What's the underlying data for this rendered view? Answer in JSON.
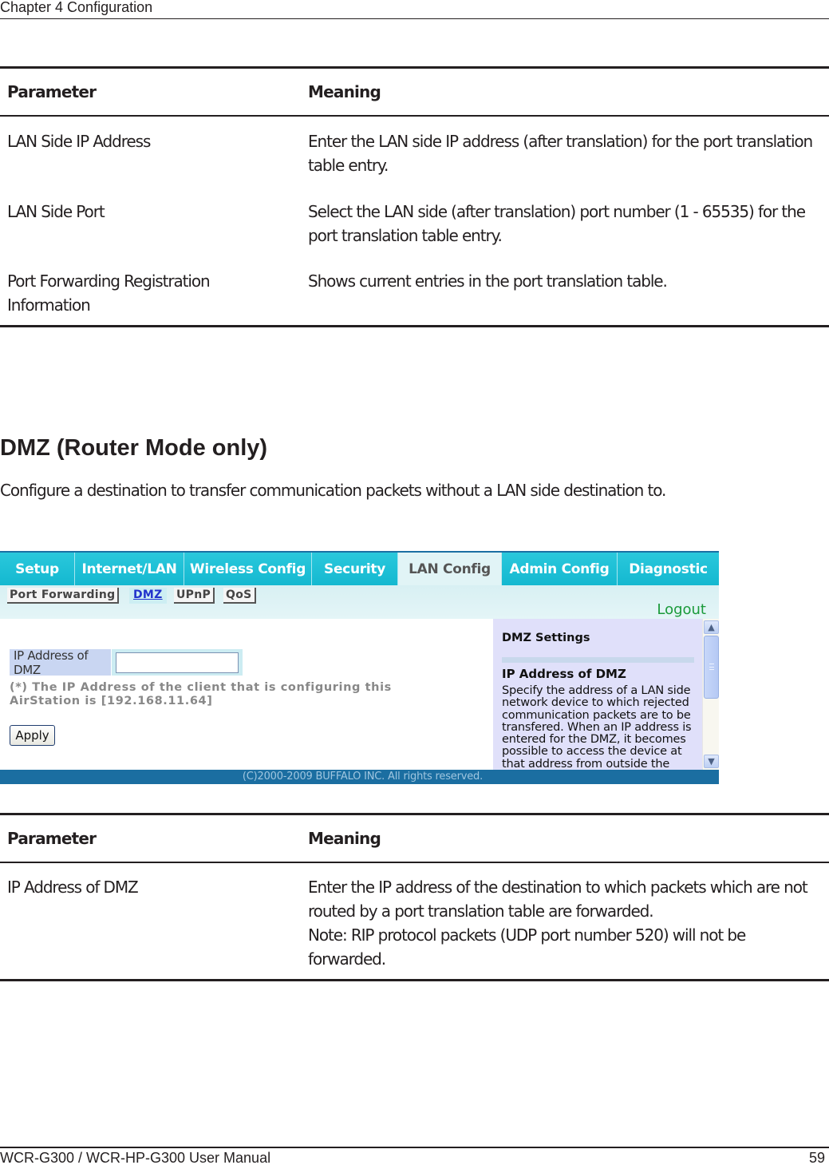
{
  "header": {
    "chapter": "Chapter 4  Configuration"
  },
  "table1": {
    "col_param": "Parameter",
    "col_meaning": "Meaning",
    "rows": [
      {
        "param": "LAN Side IP Address",
        "meaning": "Enter the LAN side IP address (after translation) for the port translation table entry."
      },
      {
        "param": "LAN Side Port",
        "meaning": "Select the LAN side (after translation) port number (1 - 65535) for the port translation table entry."
      },
      {
        "param": "Port Forwarding Registration Information",
        "meaning": "Shows current entries in the port translation table."
      }
    ]
  },
  "section": {
    "title": "DMZ (Router Mode only)",
    "description": "Configure a destination to transfer communication packets without a LAN side destination to."
  },
  "router_ui": {
    "tabs": [
      {
        "label": "Setup",
        "active": false
      },
      {
        "label": "Internet/LAN",
        "active": false
      },
      {
        "label": "Wireless Config",
        "active": false
      },
      {
        "label": "Security",
        "active": false
      },
      {
        "label": "LAN Config",
        "active": true
      },
      {
        "label": "Admin Config",
        "active": false
      },
      {
        "label": "Diagnostic",
        "active": false
      }
    ],
    "subtabs": [
      {
        "label": "Port Forwarding",
        "active": false
      },
      {
        "label": "DMZ",
        "active": true
      },
      {
        "label": "UPnP",
        "active": false
      },
      {
        "label": "QoS",
        "active": false
      }
    ],
    "logout": "Logout",
    "ip_label": "IP Address of DMZ",
    "ip_value": "",
    "note": "(*) The IP Address of the client that is configuring this AirStation is [192.168.11.64]",
    "apply": "Apply",
    "help": {
      "title": "DMZ Settings",
      "subtitle": "IP Address of DMZ",
      "body": "Specify the address of a LAN side network device to which rejected communication packets are to be transfered. When an IP address is entered for the DMZ, it becomes possible to access the device at that address from outside the"
    },
    "scroll_up": "▲",
    "scroll_down": "▼",
    "footer": "(C)2000-2009 BUFFALO INC. All rights reserved.",
    "colors": {
      "tab": "#1fc2d8",
      "footer": "#1b6ea1",
      "help_bg": "#e0e0fa",
      "logout": "#1a9a3a"
    }
  },
  "table2": {
    "col_param": "Parameter",
    "col_meaning": "Meaning",
    "rows": [
      {
        "param": "IP Address of DMZ",
        "meaning": "Enter the IP address of the destination to which packets which are not routed by a port translation table are forwarded.",
        "note": "Note: RIP protocol packets (UDP port number 520) will not be forwarded."
      }
    ]
  },
  "footer": {
    "title": "WCR-G300 / WCR-HP-G300 User Manual",
    "page": "59"
  }
}
